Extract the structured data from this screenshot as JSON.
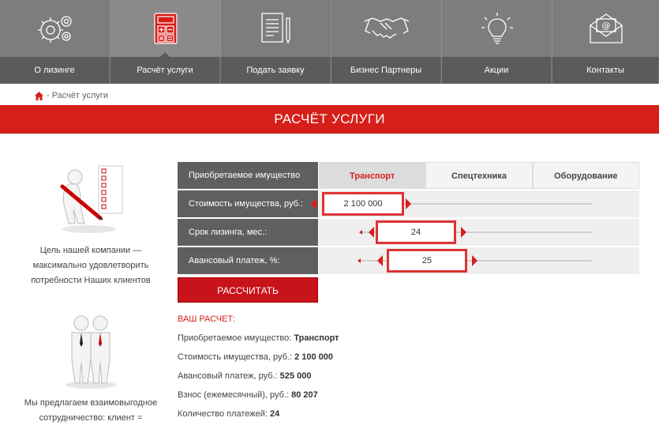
{
  "nav": [
    {
      "label": "О лизинге",
      "icon": "gears-icon"
    },
    {
      "label": "Расчёт услуги",
      "icon": "calculator-icon",
      "active": true
    },
    {
      "label": "Подать заявку",
      "icon": "document-pen-icon"
    },
    {
      "label": "Бизнес Партнеры",
      "icon": "handshake-icon"
    },
    {
      "label": "Акции",
      "icon": "lightbulb-icon"
    },
    {
      "label": "Контакты",
      "icon": "envelope-icon"
    }
  ],
  "breadcrumb": {
    "current": "- Расчёт услуги"
  },
  "page_title": "РАСЧЁТ УСЛУГИ",
  "left": {
    "caption1": "Цель нашей компании — максимально удовлетворить потребности Наших клиентов",
    "caption2": "Мы предлагаем взаимовыгодное сотрудничество: клиент = партнер"
  },
  "calc": {
    "property_label": "Приобретаемое имущество",
    "tabs": [
      "Транспорт",
      "Спецтехника",
      "Оборудование"
    ],
    "active_tab": "Транспорт",
    "cost_label": "Стоимость имущества, руб.:",
    "cost_value": "2 100 000",
    "term_label": "Срок лизинга, мес.:",
    "term_value": "24",
    "advance_label": "Авансовый платеж, %:",
    "advance_value": "25",
    "button": "РАССЧИТАТЬ"
  },
  "results": {
    "heading": "ВАШ РАСЧЕТ:",
    "property_label": "Приобретаемое имущество:",
    "property_value": "Транспорт",
    "cost_label": "Стоимость имущества, руб.:",
    "cost_value": "2 100 000",
    "advance_label": "Авансовый платеж, руб.:",
    "advance_value": "525 000",
    "monthly_label": "Взнос (ежемесячный), руб.:",
    "monthly_value": "80 207",
    "count_label": "Количество платежей:",
    "count_value": "24"
  },
  "colors": {
    "accent": "#d71f1a",
    "nav_bg": "#7d7d7d",
    "nav_label_bg": "#5b5b5b"
  }
}
